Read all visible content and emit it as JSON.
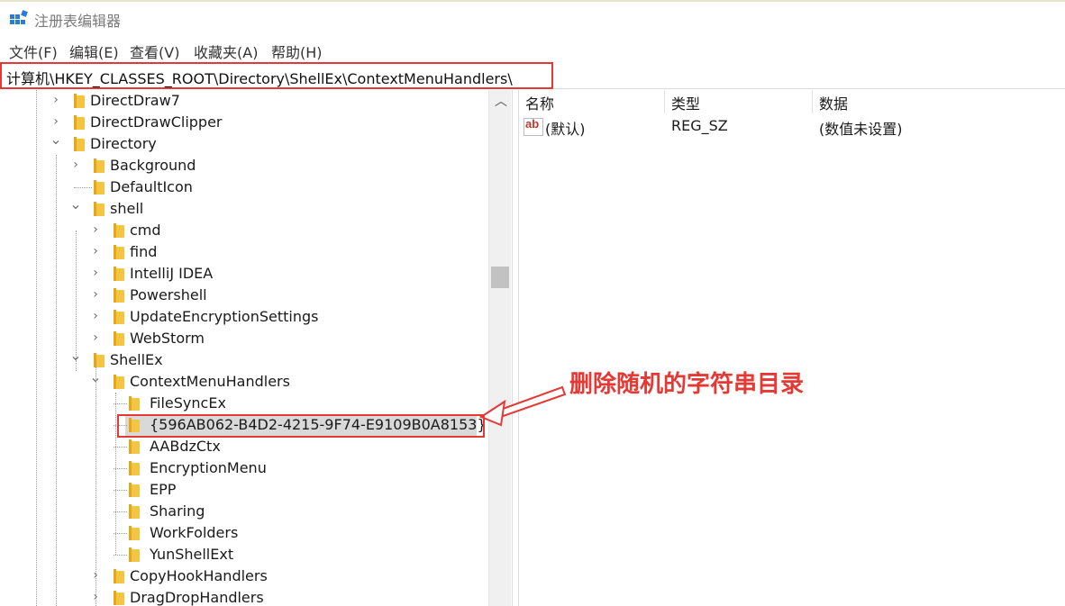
{
  "window": {
    "title": "注册表编辑器"
  },
  "menu": [
    "文件(F)",
    "编辑(E)",
    "查看(V)",
    "收藏夹(A)",
    "帮助(H)"
  ],
  "address": "计算机\\HKEY_CLASSES_ROOT\\Directory\\ShellEx\\ContextMenuHandlers\\",
  "tree": [
    {
      "label": "DirectDraw7",
      "expander": "collapsed"
    },
    {
      "label": "DirectDrawClipper",
      "expander": "collapsed"
    },
    {
      "label": "Directory",
      "expander": "expanded"
    },
    {
      "label": "Background",
      "expander": "collapsed"
    },
    {
      "label": "DefaultIcon",
      "expander": "none"
    },
    {
      "label": "shell",
      "expander": "expanded"
    },
    {
      "label": "cmd",
      "expander": "collapsed"
    },
    {
      "label": "find",
      "expander": "collapsed"
    },
    {
      "label": "IntelliJ IDEA",
      "expander": "collapsed"
    },
    {
      "label": "Powershell",
      "expander": "collapsed"
    },
    {
      "label": "UpdateEncryptionSettings",
      "expander": "collapsed"
    },
    {
      "label": "WebStorm",
      "expander": "collapsed"
    },
    {
      "label": "ShellEx",
      "expander": "expanded"
    },
    {
      "label": "ContextMenuHandlers",
      "expander": "expanded"
    },
    {
      "label": " FileSyncEx",
      "expander": "none"
    },
    {
      "label": "{596AB062-B4D2-4215-9F74-E9109B0A8153}",
      "expander": "none",
      "selected": true
    },
    {
      "label": "AABdzCtx",
      "expander": "none"
    },
    {
      "label": "EncryptionMenu",
      "expander": "none"
    },
    {
      "label": "EPP",
      "expander": "none"
    },
    {
      "label": "Sharing",
      "expander": "none"
    },
    {
      "label": "WorkFolders",
      "expander": "none"
    },
    {
      "label": "YunShellExt",
      "expander": "none"
    },
    {
      "label": "CopyHookHandlers",
      "expander": "collapsed"
    },
    {
      "label": "DragDropHandlers",
      "expander": "collapsed"
    }
  ],
  "columns": {
    "name": "名称",
    "type": "类型",
    "data": "数据"
  },
  "values": [
    {
      "icon": "string-value-icon",
      "icon_text": "ab",
      "name": "(默认)",
      "type": "REG_SZ",
      "data": "(数值未设置)"
    }
  ],
  "annotation": "删除随机的字符串目录",
  "colors": {
    "annotation": "#e53935",
    "folder": "#f4c542",
    "selection": "#d9d9d9"
  }
}
